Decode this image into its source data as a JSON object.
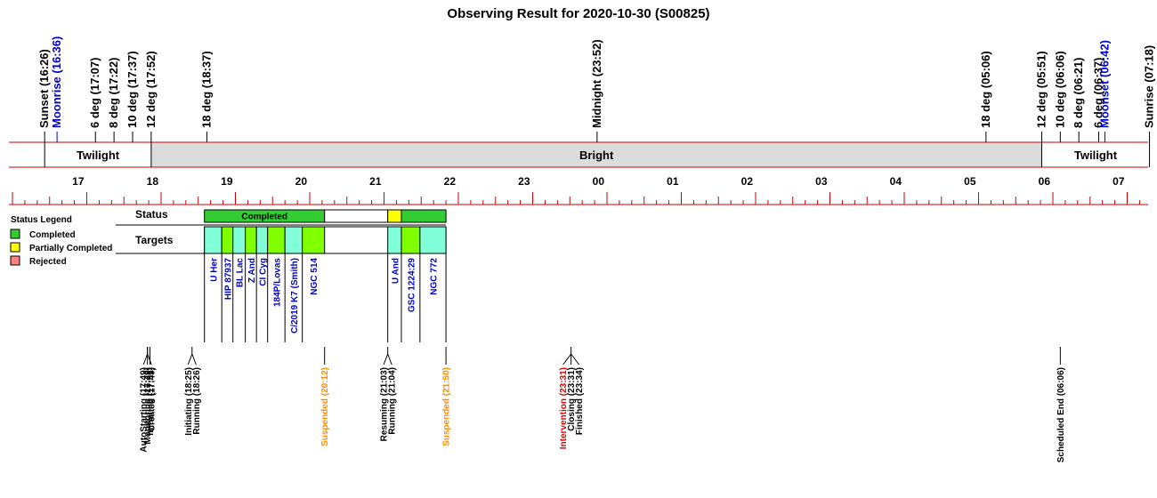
{
  "chart_data": {
    "type": "timeline",
    "title": "Observing Result for 2020-10-30 (S00825)",
    "x_axis": {
      "unit": "hour",
      "range": [
        "16:26",
        "07:18"
      ],
      "tick_labels": [
        "17",
        "18",
        "19",
        "20",
        "21",
        "22",
        "23",
        "00",
        "01",
        "02",
        "03",
        "04",
        "05",
        "06",
        "07"
      ]
    },
    "header_markers": [
      {
        "label": "Sunset (16:26)",
        "time": "16:26",
        "color": "#000000"
      },
      {
        "label": "Moonrise (16:36)",
        "time": "16:36",
        "color": "#0000cc"
      },
      {
        "label": "6 deg (17:07)",
        "time": "17:07",
        "color": "#000000"
      },
      {
        "label": "8 deg (17:22)",
        "time": "17:22",
        "color": "#000000"
      },
      {
        "label": "10 deg (17:37)",
        "time": "17:37",
        "color": "#000000"
      },
      {
        "label": "12 deg (17:52)",
        "time": "17:52",
        "color": "#000000"
      },
      {
        "label": "18 deg (18:37)",
        "time": "18:37",
        "color": "#000000"
      },
      {
        "label": "Midnight (23:52)",
        "time": "23:52",
        "color": "#000000"
      },
      {
        "label": "18 deg (05:06)",
        "time": "05:06",
        "color": "#000000"
      },
      {
        "label": "12 deg (05:51)",
        "time": "05:51",
        "color": "#000000"
      },
      {
        "label": "10 deg (06:06)",
        "time": "06:06",
        "color": "#000000"
      },
      {
        "label": "8 deg (06:21)",
        "time": "06:21",
        "color": "#000000"
      },
      {
        "label": "6 deg (06:37)",
        "time": "06:37",
        "color": "#000000"
      },
      {
        "label": "Moonset (06:42)",
        "time": "06:42",
        "color": "#0000cc"
      },
      {
        "label": "Sunrise (07:18)",
        "time": "07:18",
        "color": "#000000"
      }
    ],
    "bands": [
      {
        "label": "Twilight",
        "start": "16:26",
        "end": "17:52",
        "fill": "#ffffff"
      },
      {
        "label": "Bright",
        "start": "17:52",
        "end": "05:51",
        "fill": "#dcdcdc"
      },
      {
        "label": "Twilight",
        "start": "05:51",
        "end": "07:18",
        "fill": "#ffffff"
      }
    ],
    "status_row_label": "Status",
    "targets_row_label": "Targets",
    "status_segments": [
      {
        "start": "18:35",
        "end": "20:12",
        "status": "completed",
        "label": "Completed"
      },
      {
        "start": "20:12",
        "end": "21:03",
        "status": "none",
        "label": ""
      },
      {
        "start": "21:03",
        "end": "21:14",
        "status": "partial",
        "label": ""
      },
      {
        "start": "21:14",
        "end": "21:50",
        "status": "completed",
        "label": ""
      }
    ],
    "targets": [
      {
        "name": "U Her",
        "start": "18:35",
        "end": "18:49",
        "fill": "#80ffd8"
      },
      {
        "name": "HIP 87937",
        "start": "18:49",
        "end": "18:58",
        "fill": "#80ff00"
      },
      {
        "name": "BL Lac",
        "start": "18:58",
        "end": "19:08",
        "fill": "#80ffd8"
      },
      {
        "name": "Z And",
        "start": "19:08",
        "end": "19:17",
        "fill": "#80ff00"
      },
      {
        "name": "CI Cyg",
        "start": "19:17",
        "end": "19:26",
        "fill": "#80ffd8"
      },
      {
        "name": "184P/Lovas",
        "start": "19:26",
        "end": "19:40",
        "fill": "#80ff00"
      },
      {
        "name": "C/2019 K7 (Smith)",
        "start": "19:40",
        "end": "19:54",
        "fill": "#80ffd8"
      },
      {
        "name": "NGC 514",
        "start": "19:54",
        "end": "20:12",
        "fill": "#80ff00"
      },
      {
        "name": "U And",
        "start": "21:03",
        "end": "21:14",
        "fill": "#80ffd8"
      },
      {
        "name": "GSC 1224:29",
        "start": "21:14",
        "end": "21:29",
        "fill": "#80ff00"
      },
      {
        "name": "NGC 772",
        "start": "21:29",
        "end": "21:50",
        "fill": "#80ffd8"
      }
    ],
    "events": [
      {
        "time": "17:49",
        "lines": [
          {
            "text": "Monitoring (17:49)",
            "color": "#000000"
          }
        ]
      },
      {
        "time": "17:49",
        "lines": [
          {
            "text": "AutoStarting (17:49)",
            "color": "#000000"
          },
          {
            "text": "Created (17:49)",
            "color": "#000000"
          }
        ]
      },
      {
        "time": "17:51",
        "lines": [
          {
            "text": "Initiating (17:51)",
            "color": "#000000"
          }
        ]
      },
      {
        "time": "18:25",
        "lines": [
          {
            "text": "Initiating (18:25)",
            "color": "#000000"
          },
          {
            "text": "Running (18:26)",
            "color": "#000000"
          }
        ]
      },
      {
        "time": "20:12",
        "lines": [
          {
            "text": "Suspended (20:12)",
            "color": "#ff8c00"
          }
        ]
      },
      {
        "time": "21:03",
        "lines": [
          {
            "text": "Resuming (21:03)",
            "color": "#000000"
          },
          {
            "text": "Running (21:04)",
            "color": "#000000"
          }
        ]
      },
      {
        "time": "21:50",
        "lines": [
          {
            "text": "Suspended (21:50)",
            "color": "#ff8c00"
          }
        ]
      },
      {
        "time": "23:31",
        "lines": [
          {
            "text": "Intervention (23:31)",
            "color": "#e00000"
          },
          {
            "text": "Closing (23:31)",
            "color": "#000000"
          },
          {
            "text": "Finished (23:34)",
            "color": "#000000"
          }
        ]
      },
      {
        "time": "06:06",
        "lines": [
          {
            "text": "Scheduled End (06:06)",
            "color": "#000000"
          }
        ]
      }
    ],
    "legend": {
      "title": "Status Legend",
      "items": [
        {
          "label": "Completed",
          "color": "#33cc33"
        },
        {
          "label": "Partially Completed",
          "color": "#ffff00"
        },
        {
          "label": "Rejected",
          "color": "#ff8080"
        }
      ]
    },
    "colors": {
      "axis_red": "#cc0000",
      "completed": "#33cc33",
      "partial": "#ffff00",
      "rejected": "#ff8080"
    }
  }
}
